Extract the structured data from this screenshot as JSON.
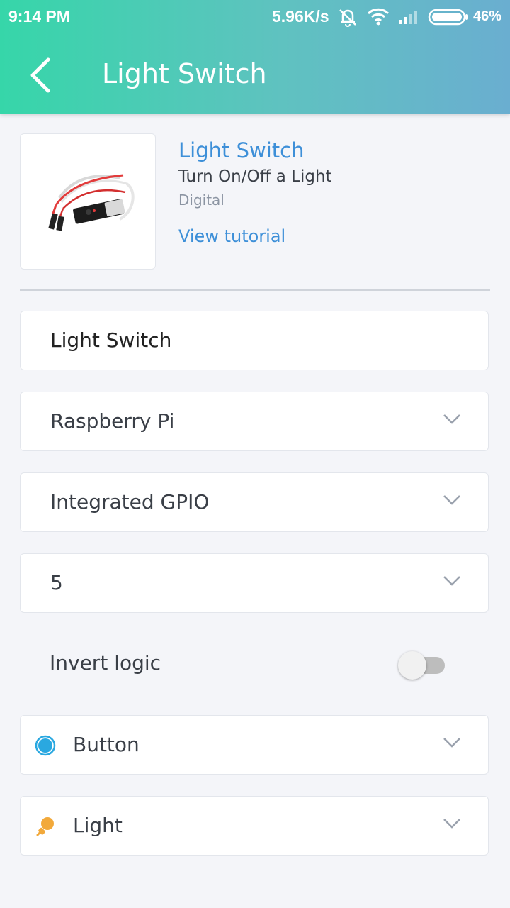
{
  "status_bar": {
    "time": "9:14 PM",
    "net_speed": "5.96K/s",
    "battery_pct": "46%",
    "icons": [
      "mute-alarm-icon",
      "wifi-icon",
      "signal-icon",
      "battery-icon"
    ]
  },
  "app_bar": {
    "title": "Light Switch",
    "back_icon": "chevron-left-icon"
  },
  "widget": {
    "name": "Light Switch",
    "description": "Turn On/Off a Light",
    "type": "Digital",
    "tutorial_link": "View tutorial",
    "image_icon": "relay-module-image"
  },
  "form": {
    "name_value": "Light Switch",
    "device": "Raspberry Pi",
    "connection": "Integrated GPIO",
    "pin": "5",
    "invert_label": "Invert logic",
    "invert_on": false,
    "mode": "Button",
    "mode_icon": "button-circle-icon",
    "output": "Light",
    "output_icon": "lightbulb-icon"
  },
  "colors": {
    "header_start": "#36d6a9",
    "header_end": "#6aaed0",
    "link": "#3d8fd8",
    "button_icon": "#2aa8e0",
    "light_icon": "#f2a93b"
  }
}
